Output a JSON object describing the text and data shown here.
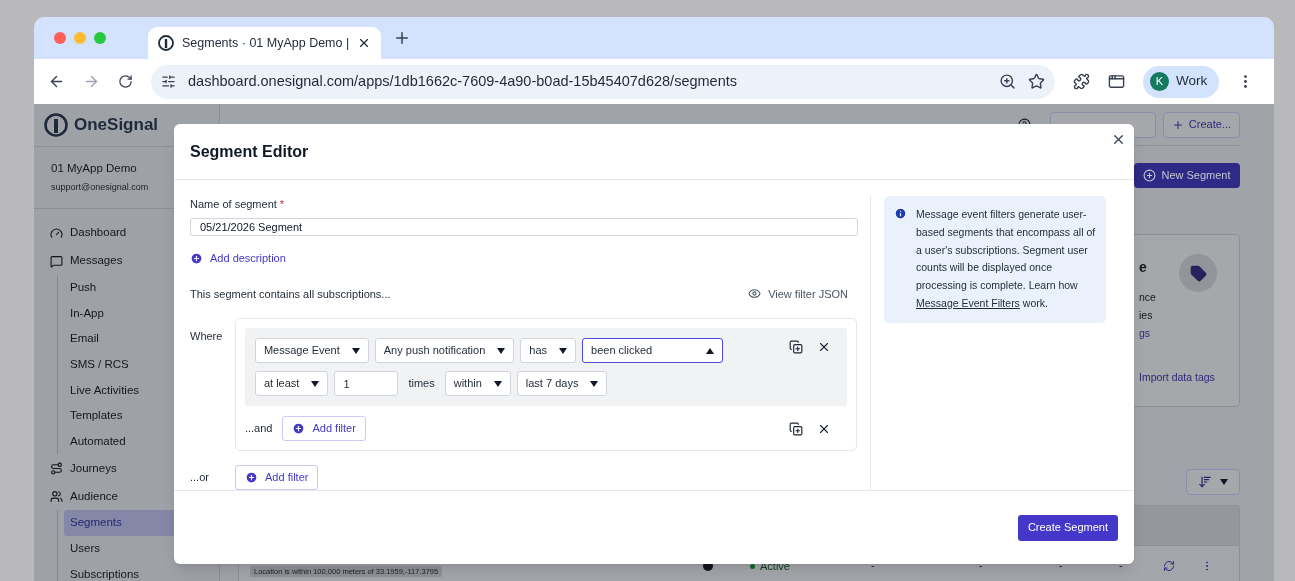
{
  "browser": {
    "tab_title": "Segments · 01 MyApp Demo |",
    "url": "dashboard.onesignal.com/apps/1db1662c-7609-4a90-b0ad-15b45407d628/segments",
    "profile_initial": "K",
    "profile_name": "Work"
  },
  "sidebar": {
    "brand": "OneSignal",
    "app_name": "01 MyApp Demo",
    "email": "support@onesignal.com",
    "items": [
      {
        "label": "Dashboard",
        "selected": false
      },
      {
        "label": "Messages",
        "selected": false,
        "children": [
          {
            "label": "Push",
            "selected": false
          },
          {
            "label": "In-App",
            "selected": false
          },
          {
            "label": "Email",
            "selected": false
          },
          {
            "label": "SMS / RCS",
            "selected": false
          },
          {
            "label": "Live Activities",
            "selected": false
          },
          {
            "label": "Templates",
            "selected": false
          },
          {
            "label": "Automated",
            "selected": false
          }
        ]
      },
      {
        "label": "Journeys",
        "selected": false
      },
      {
        "label": "Audience",
        "selected": false,
        "children": [
          {
            "label": "Segments",
            "selected": true
          },
          {
            "label": "Users",
            "selected": false
          },
          {
            "label": "Subscriptions",
            "selected": false
          }
        ]
      }
    ]
  },
  "header": {
    "create_button": "Create...",
    "new_segment_button": "New Segment"
  },
  "background_card": {
    "fragments": [
      {
        "kind": "title",
        "text": "e"
      },
      {
        "kind": "text",
        "text": "nce"
      },
      {
        "kind": "text",
        "text": "ies"
      },
      {
        "kind": "link",
        "text": "gs"
      }
    ],
    "link": "Import data tags"
  },
  "table_row": {
    "status": "Active",
    "cells": [
      "-",
      "-",
      "-",
      "-"
    ],
    "tag": "Location is within 100,000 meters of 33.1959,-117.3795"
  },
  "modal": {
    "title": "Segment Editor",
    "name_label": "Name of segment",
    "required_mark": "*",
    "name_value": "05/21/2026 Segment",
    "add_description": "Add description",
    "contains_text": "This segment contains all subscriptions...",
    "view_json": "View filter JSON",
    "where_label": "Where",
    "filter_lines": [
      {
        "fields": [
          {
            "kind": "select",
            "value": "Message Event",
            "open": false
          },
          {
            "kind": "select",
            "value": "Any push notification",
            "open": false
          },
          {
            "kind": "select",
            "value": "has",
            "open": false
          },
          {
            "kind": "select",
            "value": "been clicked",
            "open": true
          }
        ]
      },
      {
        "fields": [
          {
            "kind": "select",
            "value": "at least",
            "open": false
          },
          {
            "kind": "input",
            "value": "1"
          },
          {
            "kind": "text",
            "value": "times"
          },
          {
            "kind": "select",
            "value": "within",
            "open": false
          },
          {
            "kind": "select",
            "value": "last 7 days",
            "open": false
          }
        ]
      }
    ],
    "and_label": "...and",
    "add_filter": "Add filter",
    "or_label": "...or",
    "or_add_filter": "Add filter",
    "info": "Message event filters generate user-based segments that encompass all of a user's subscriptions. Segment user counts will be displayed once processing is complete. Learn how",
    "info_link": "Message Event Filters",
    "info_tail": "work.",
    "submit": "Create Segment"
  }
}
